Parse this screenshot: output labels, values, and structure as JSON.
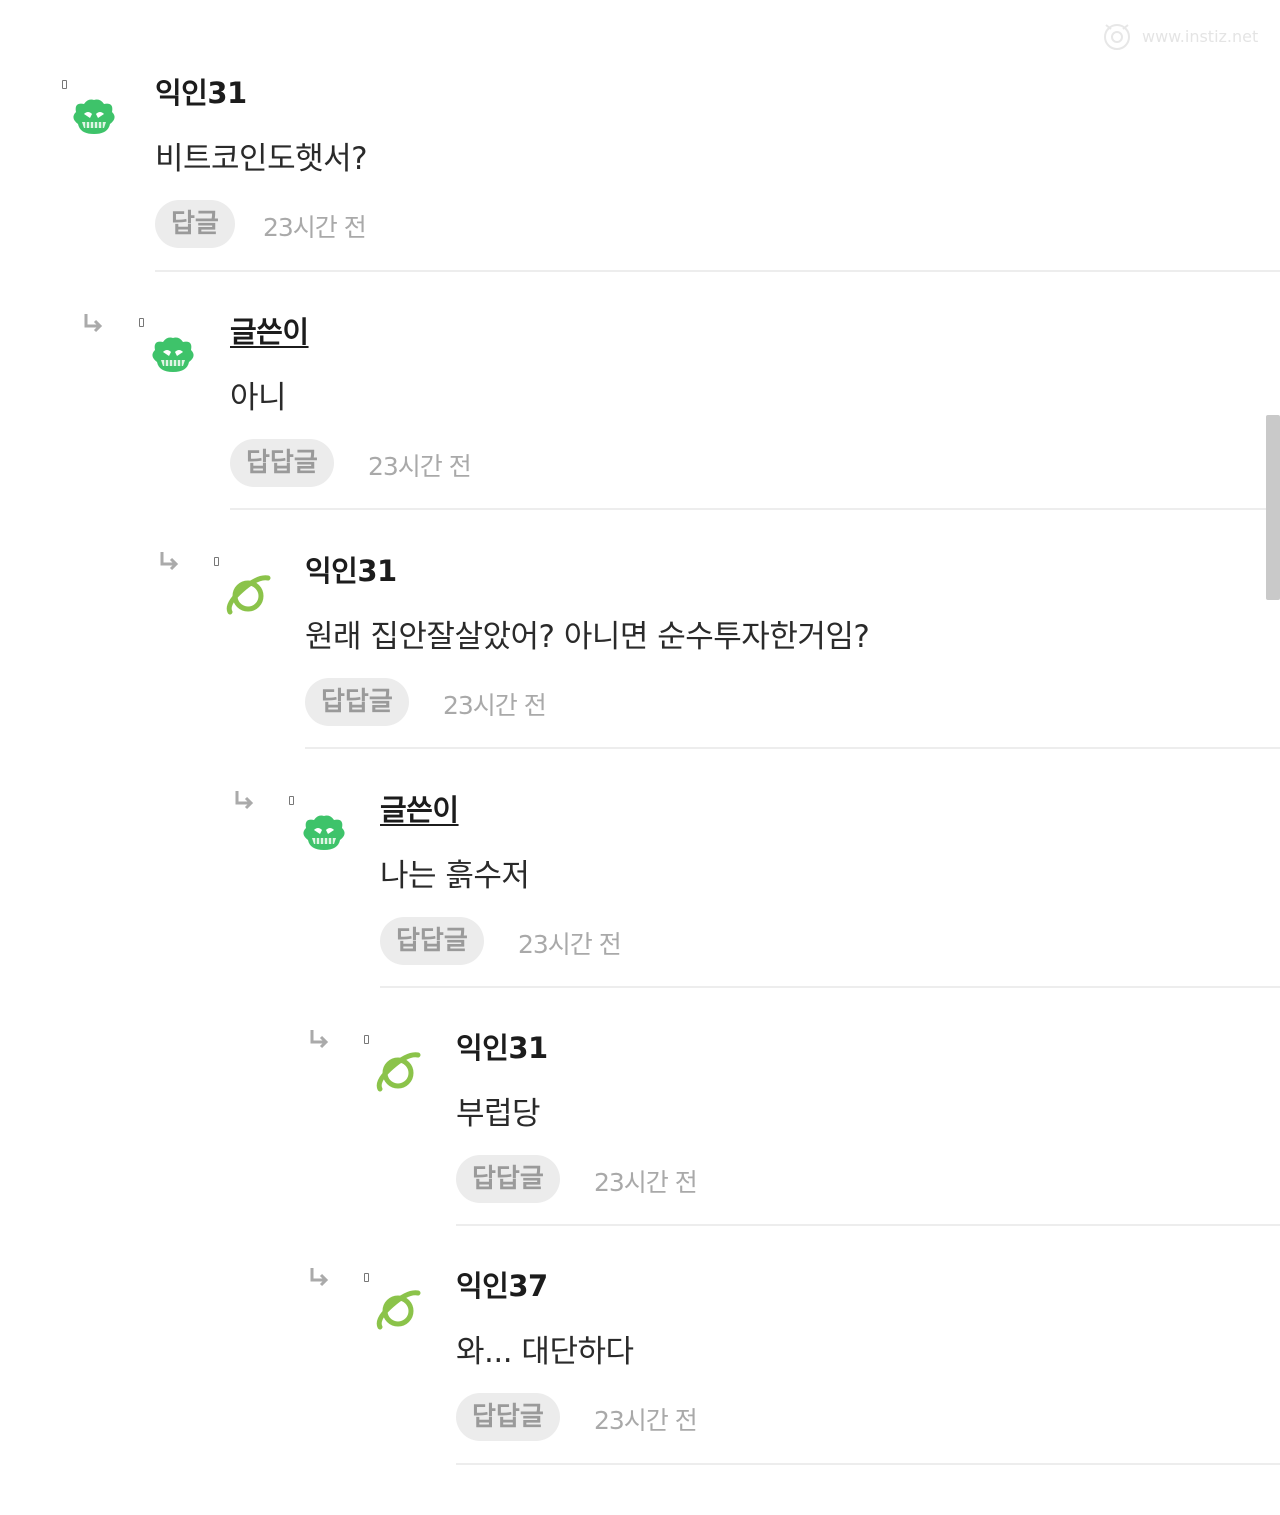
{
  "watermark": {
    "text": "www.instiz.net"
  },
  "comments": [
    {
      "author": "익인31",
      "text": "비트코인도햇서?",
      "reply_label": "답글",
      "time": "23시간 전",
      "avatar": "alien-icon",
      "is_op": false
    },
    {
      "author": "글쓴이",
      "text": "아니",
      "reply_label": "답답글",
      "time": "23시간 전",
      "avatar": "alien-icon",
      "is_op": true
    },
    {
      "author": "익인31",
      "text": "원래 집안잘살았어? 아니면 순수투자한거임?",
      "reply_label": "답답글",
      "time": "23시간 전",
      "avatar": "planet-icon",
      "is_op": false
    },
    {
      "author": "글쓴이",
      "text": "나는 흙수저",
      "reply_label": "답답글",
      "time": "23시간 전",
      "avatar": "alien-icon",
      "is_op": true
    },
    {
      "author": "익인31",
      "text": "부럽당",
      "reply_label": "답답글",
      "time": "23시간 전",
      "avatar": "planet-icon",
      "is_op": false
    },
    {
      "author": "익인37",
      "text": "와... 대단하다",
      "reply_label": "답답글",
      "time": "23시간 전",
      "avatar": "planet-icon",
      "is_op": false
    }
  ]
}
